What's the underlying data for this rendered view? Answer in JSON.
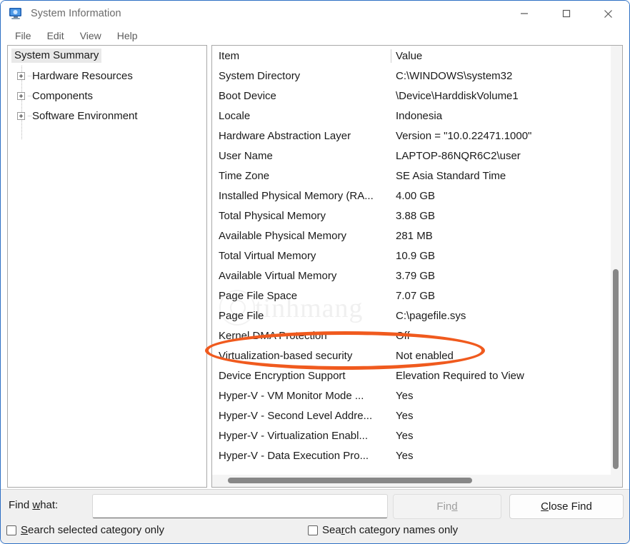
{
  "window": {
    "title": "System Information",
    "icon": "computer-monitor-icon",
    "controls": {
      "minimize": "minimize-icon",
      "maximize": "maximize-icon",
      "close": "close-icon"
    }
  },
  "menubar": {
    "items": [
      {
        "label": "File"
      },
      {
        "label": "Edit"
      },
      {
        "label": "View"
      },
      {
        "label": "Help"
      }
    ]
  },
  "tree": {
    "selected": "System Summary",
    "items": [
      {
        "label": "System Summary",
        "expandable": false,
        "selected": true
      },
      {
        "label": "Hardware Resources",
        "expandable": true,
        "selected": false
      },
      {
        "label": "Components",
        "expandable": true,
        "selected": false
      },
      {
        "label": "Software Environment",
        "expandable": true,
        "selected": false
      }
    ]
  },
  "detail": {
    "columns": {
      "item": "Item",
      "value": "Value"
    },
    "rows": [
      {
        "item": "System Directory",
        "value": "C:\\WINDOWS\\system32"
      },
      {
        "item": "Boot Device",
        "value": "\\Device\\HarddiskVolume1"
      },
      {
        "item": "Locale",
        "value": "Indonesia"
      },
      {
        "item": "Hardware Abstraction Layer",
        "value": "Version = \"10.0.22471.1000\""
      },
      {
        "item": "User Name",
        "value": "LAPTOP-86NQR6C2\\user"
      },
      {
        "item": "Time Zone",
        "value": "SE Asia Standard Time"
      },
      {
        "item": "Installed Physical Memory (RA...",
        "value": "4.00 GB"
      },
      {
        "item": "Total Physical Memory",
        "value": "3.88 GB"
      },
      {
        "item": "Available Physical Memory",
        "value": "281 MB"
      },
      {
        "item": "Total Virtual Memory",
        "value": "10.9 GB"
      },
      {
        "item": "Available Virtual Memory",
        "value": "3.79 GB"
      },
      {
        "item": "Page File Space",
        "value": "7.07 GB"
      },
      {
        "item": "Page File",
        "value": "C:\\pagefile.sys"
      },
      {
        "item": "Kernel DMA Protection",
        "value": "Off"
      },
      {
        "item": "Virtualization-based security",
        "value": "Not enabled"
      },
      {
        "item": "Device Encryption Support",
        "value": "Elevation Required to View"
      },
      {
        "item": "Hyper-V - VM Monitor Mode ...",
        "value": "Yes"
      },
      {
        "item": "Hyper-V - Second Level Addre...",
        "value": "Yes"
      },
      {
        "item": "Hyper-V - Virtualization Enabl...",
        "value": "Yes"
      },
      {
        "item": "Hyper-V - Data Execution Pro...",
        "value": "Yes"
      }
    ]
  },
  "annotation": {
    "color": "#f05a1e",
    "target_row": "Virtualization-based security"
  },
  "watermark": {
    "text": "tinhmang"
  },
  "findbar": {
    "label_prefix": "Find ",
    "label_accel": "w",
    "label_suffix": "hat:",
    "input_value": "",
    "input_placeholder": "",
    "find_button": {
      "prefix": "Fin",
      "accel": "d",
      "suffix": ""
    },
    "close_button": {
      "prefix": "",
      "accel": "C",
      "suffix": "lose Find"
    },
    "checkbox_left": {
      "prefix": "",
      "accel": "S",
      "suffix": "earch selected category only",
      "checked": false
    },
    "checkbox_right": {
      "prefix": "Sea",
      "accel": "r",
      "suffix": "ch category names only",
      "checked": false
    }
  }
}
